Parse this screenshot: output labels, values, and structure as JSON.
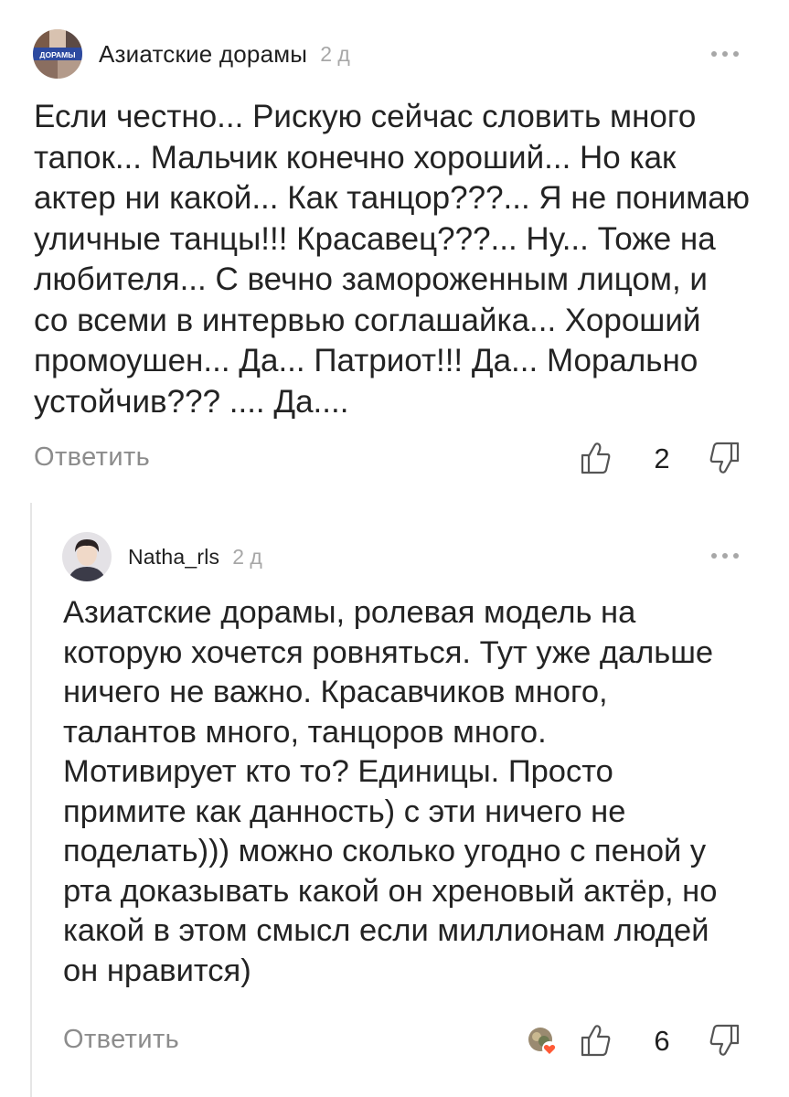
{
  "comments": [
    {
      "author": "Азиатские дорамы",
      "avatar_label": "ДОРАМЫ",
      "time": "2 д",
      "text": "Если честно... Рискую сейчас словить много\nтапок... Мальчик конечно хороший... Но как\nактер ни какой... Как танцор???... Я не понимаю\nуличные танцы!!! Красавец???... Ну... Тоже на\nлюбителя... С вечно замороженным лицом, и\nсо всеми в интервью соглашайка... Хороший\nпромоушен... Да... Патриот!!! Да... Морально\nустойчив??? .... Да....",
      "reply_label": "Ответить",
      "likes": "2"
    },
    {
      "author": "Natha_rls",
      "time": "2 д",
      "text": "Азиатские дорамы, ролевая модель на\nкоторую хочется ровняться. Тут уже дальше\nничего не важно. Красавчиков много,\nталантов много, танцоров много.\nМотивирует кто то? Единицы. Просто\nпримите как данность) с эти ничего не\nподелать))) можно сколько угодно с пеной у\nрта доказывать какой он хреновый актёр, но\nкакой в этом смысл если миллионам людей\nон нравится)",
      "reply_label": "Ответить",
      "likes": "6"
    }
  ],
  "icons": {
    "more": "more-horizontal-icon",
    "like": "thumb-up-icon",
    "dislike": "thumb-down-icon",
    "reaction": "heart-reaction-icon"
  },
  "colors": {
    "text": "#232323",
    "muted": "#8c8c8c",
    "time": "#a7a7a7",
    "heart": "#ff5a36"
  }
}
